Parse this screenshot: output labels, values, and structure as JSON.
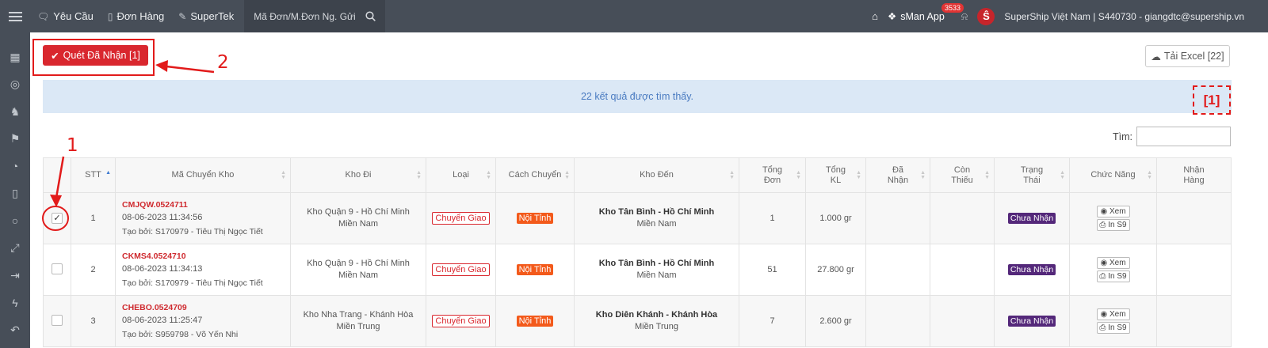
{
  "nav": {
    "items": [
      {
        "label": "Yêu Cầu",
        "icon": "chat-icon"
      },
      {
        "label": "Đơn Hàng",
        "icon": "book-icon"
      },
      {
        "label": "SuperTek",
        "icon": "edit-icon"
      }
    ],
    "search_label": "Mã Đơn/M.Đơn Ng. Gửi",
    "app_label": "sMan App",
    "app_badge": "3533",
    "account": "SuperShip Việt Nam | S440730 - giangdtc@supership.vn",
    "logo_letter": "Ŝ"
  },
  "sidebar": {
    "icons": [
      "grid-icon",
      "compass-icon",
      "chess-knight-icon",
      "flag-icon",
      "palette-icon",
      "book-icon",
      "bulb-icon",
      "expand-icon",
      "sign-in-icon",
      "bolt-icon",
      "reply-icon"
    ]
  },
  "toolbar": {
    "scan_button": "Quét Đã Nhận [1]",
    "excel_button": "Tải Excel [22]"
  },
  "result_text": "22 kết quả được tìm thấy.",
  "search": {
    "label": "Tìm:",
    "value": ""
  },
  "table": {
    "headers": [
      "STT",
      "Mã Chuyển Kho",
      "Kho Đi",
      "Loại",
      "Cách Chuyển",
      "Kho Đến",
      "Tổng Đơn",
      "Tổng KL",
      "Đã Nhận",
      "Còn Thiếu",
      "Trạng Thái",
      "Chức Năng",
      "Nhận Hàng"
    ],
    "rows": [
      {
        "checked": true,
        "stt": "1",
        "code": "CMJQW.0524711",
        "datetime": "08-06-2023 11:34:56",
        "created_by": "Tạo bởi: S170979 - Tiêu Thị Ngọc Tiết",
        "from_name": "Kho Quận 9 - Hồ Chí Minh",
        "from_region": "Miền Nam",
        "type": "Chuyển Giao",
        "route": "Nội Tỉnh",
        "to_name": "Kho Tân Bình - Hồ Chí Minh",
        "to_region": "Miền Nam",
        "total_orders": "1",
        "total_weight": "1.000 gr",
        "received": "",
        "missing": "",
        "status": "Chưa Nhận",
        "view": "Xem",
        "print": "In S9"
      },
      {
        "checked": false,
        "stt": "2",
        "code": "CKMS4.0524710",
        "datetime": "08-06-2023 11:34:13",
        "created_by": "Tạo bởi: S170979 - Tiêu Thị Ngọc Tiết",
        "from_name": "Kho Quận 9 - Hồ Chí Minh",
        "from_region": "Miền Nam",
        "type": "Chuyển Giao",
        "route": "Nội Tỉnh",
        "to_name": "Kho Tân Bình - Hồ Chí Minh",
        "to_region": "Miền Nam",
        "total_orders": "51",
        "total_weight": "27.800 gr",
        "received": "",
        "missing": "",
        "status": "Chưa Nhận",
        "view": "Xem",
        "print": "In S9"
      },
      {
        "checked": false,
        "stt": "3",
        "code": "CHEBO.0524709",
        "datetime": "08-06-2023 11:25:47",
        "created_by": "Tạo bởi: S959798 - Võ Yến Nhi",
        "from_name": "Kho Nha Trang - Khánh Hòa",
        "from_region": "Miền Trung",
        "type": "Chuyển Giao",
        "route": "Nội Tỉnh",
        "to_name": "Kho Diên Khánh - Khánh Hòa",
        "to_region": "Miền Trung",
        "total_orders": "7",
        "total_weight": "2.600 gr",
        "received": "",
        "missing": "",
        "status": "Chưa Nhận",
        "view": "Xem",
        "print": "In S9"
      }
    ]
  },
  "annotations": {
    "step1": "1",
    "step2": "2",
    "tag": "[1]"
  },
  "colors": {
    "nav_bg": "#474e58",
    "accent_red": "#d9272e",
    "info_bg": "#dbe8f6",
    "status_purple": "#54287a",
    "route_orange": "#f35a1b"
  }
}
